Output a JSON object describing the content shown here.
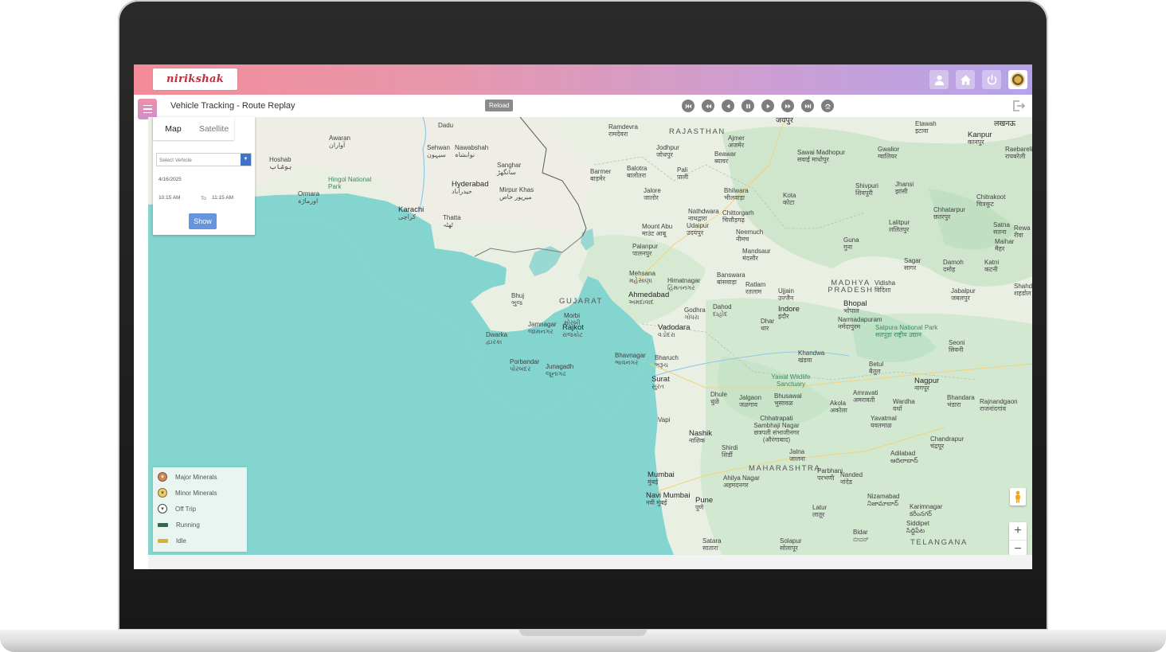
{
  "app": {
    "logo_text": "nirikshak",
    "page_title": "Vehicle Tracking - Route Replay",
    "reload_label": "Reload"
  },
  "header_icons": [
    "user-icon",
    "home-icon",
    "power-icon",
    "emblem-icon"
  ],
  "player_controls": [
    "skip-start-icon",
    "rewind-icon",
    "step-back-icon",
    "pause-icon",
    "play-icon",
    "fast-forward-icon",
    "skip-end-icon",
    "speed-icon"
  ],
  "map_type": {
    "tabs": [
      "Map",
      "Satellite"
    ],
    "active": "Map"
  },
  "filters": {
    "vehicle_placeholder": "Select Vehicle",
    "date": "4/16/2025",
    "time_from": "10:15 AM",
    "time_to_label": "To",
    "time_to": "11:15 AM",
    "show_label": "Show"
  },
  "legend": [
    {
      "label": "Major Minerals",
      "color": "#c98858"
    },
    {
      "label": "Minor Minerals",
      "color": "#e8cd7a"
    },
    {
      "label": "Off Trip",
      "color": "#ffffff"
    },
    {
      "label": "Running",
      "color": "#2f6b4a"
    },
    {
      "label": "Idle",
      "color": "#d6b13a"
    }
  ],
  "map": {
    "states": [
      "RAJASTHAN",
      "GUJARAT",
      "MADHYA PRADESH",
      "MAHARASHTRA",
      "TELANGANA"
    ],
    "cities": [
      {
        "name": "Dadu",
        "sub": ""
      },
      {
        "name": "Ramdevra",
        "sub": "रामदेवरा"
      },
      {
        "name": "जयपुर",
        "sub": ""
      },
      {
        "name": "Etawah",
        "sub": "इटावा"
      },
      {
        "name": "लखनऊ",
        "sub": ""
      },
      {
        "name": "Kanpur",
        "sub": "कानपुर"
      },
      {
        "name": "Awaran",
        "sub": "آواران"
      },
      {
        "name": "Sehwan",
        "sub": "سیہون"
      },
      {
        "name": "Nawabshah",
        "sub": "نوابشاہ"
      },
      {
        "name": "Jodhpur",
        "sub": "जोधपुर"
      },
      {
        "name": "Ajmer",
        "sub": "अजमेर"
      },
      {
        "name": "Gwalior",
        "sub": "ग्वालियर"
      },
      {
        "name": "Raebareli",
        "sub": "रायबरेली"
      },
      {
        "name": "Hoshab",
        "sub": "ہوشاب"
      },
      {
        "name": "Sanghar",
        "sub": "سانگھڑ"
      },
      {
        "name": "Beawar",
        "sub": "ब्यावर"
      },
      {
        "name": "Sawai Madhopur",
        "sub": "सवाई माधोपुर"
      },
      {
        "name": "Barmer",
        "sub": "बाड़मेर"
      },
      {
        "name": "Balotra",
        "sub": "बालोतरा"
      },
      {
        "name": "Pali",
        "sub": "पाली"
      },
      {
        "name": "Hingol National Park",
        "sub": ""
      },
      {
        "name": "Hyderabad",
        "sub": "حیدرآباد"
      },
      {
        "name": "Mirpur Khas",
        "sub": "میرپور خاص"
      },
      {
        "name": "Shivpuri",
        "sub": "शिवपुरी"
      },
      {
        "name": "Jhansi",
        "sub": "झांसी"
      },
      {
        "name": "Chitrakoot",
        "sub": "चित्रकूट"
      },
      {
        "name": "Jalore",
        "sub": "जालोर"
      },
      {
        "name": "Bhilwara",
        "sub": "भीलवाड़ा"
      },
      {
        "name": "Kota",
        "sub": "कोटा"
      },
      {
        "name": "Ormara",
        "sub": "اورماڑہ"
      },
      {
        "name": "Karachi",
        "sub": "کراچی"
      },
      {
        "name": "Thatta",
        "sub": "ٹھٹہ"
      },
      {
        "name": "Nathdwara",
        "sub": "नाथद्वारा"
      },
      {
        "name": "Chittorgarh",
        "sub": "चित्तौड़गढ़"
      },
      {
        "name": "Chhatarpur",
        "sub": "छतरपुर"
      },
      {
        "name": "Lalitpur",
        "sub": "ललितपुर"
      },
      {
        "name": "Mount Abu",
        "sub": "माउंट आबू"
      },
      {
        "name": "Udaipur",
        "sub": "उदयपुर"
      },
      {
        "name": "Neemuch",
        "sub": "नीमच"
      },
      {
        "name": "Satna",
        "sub": "सतना"
      },
      {
        "name": "Rewa",
        "sub": "रीवा"
      },
      {
        "name": "Guna",
        "sub": "गुना"
      },
      {
        "name": "Maihar",
        "sub": "मैहर"
      },
      {
        "name": "Palanpur",
        "sub": "पालनपुर"
      },
      {
        "name": "Mandsaur",
        "sub": "मंदसौर"
      },
      {
        "name": "Sagar",
        "sub": "सागर"
      },
      {
        "name": "Damoh",
        "sub": "दमोह"
      },
      {
        "name": "Katni",
        "sub": "कटनी"
      },
      {
        "name": "Mehsana",
        "sub": "મહેસાણા"
      },
      {
        "name": "Himatnagar",
        "sub": "હિંમતનગર"
      },
      {
        "name": "Banswara",
        "sub": "बांसवाड़ा"
      },
      {
        "name": "Vidisha",
        "sub": "विदिशा"
      },
      {
        "name": "Shahdol",
        "sub": "शहडोल"
      },
      {
        "name": "Ratlam",
        "sub": "रतलाम"
      },
      {
        "name": "Ujjain",
        "sub": "उज्जैन"
      },
      {
        "name": "Jabalpur",
        "sub": "जबलपुर"
      },
      {
        "name": "Bhuj",
        "sub": "ભુજ"
      },
      {
        "name": "Ahmedabad",
        "sub": "અમદાવાદ"
      },
      {
        "name": "Bhopal",
        "sub": "भोपाल"
      },
      {
        "name": "Morbi",
        "sub": "મોરબી"
      },
      {
        "name": "Godhra",
        "sub": "ગોધરા"
      },
      {
        "name": "Dahod",
        "sub": "દાહોદ"
      },
      {
        "name": "Indore",
        "sub": "इंदौर"
      },
      {
        "name": "Dhar",
        "sub": "धार"
      },
      {
        "name": "Narmadapuram",
        "sub": "नर्मदापुरम"
      },
      {
        "name": "Jamnagar",
        "sub": "જામનગર"
      },
      {
        "name": "Rajkot",
        "sub": "રાજકોટ"
      },
      {
        "name": "Vadodara",
        "sub": "વડોદરા"
      },
      {
        "name": "Satpura National Park",
        "sub": "सतपुड़ा राष्ट्रीय उद्यान"
      },
      {
        "name": "Dwarka",
        "sub": "દ્વારકા"
      },
      {
        "name": "Seoni",
        "sub": "सिवनी"
      },
      {
        "name": "Khandwa",
        "sub": "खंडवा"
      },
      {
        "name": "Bhavnagar",
        "sub": "ભાવનગર"
      },
      {
        "name": "Bharuch",
        "sub": "ભરૂચ"
      },
      {
        "name": "Porbandar",
        "sub": "પોરબંદર"
      },
      {
        "name": "Junagadh",
        "sub": "જૂનાગઢ"
      },
      {
        "name": "Betul",
        "sub": "बैतूल"
      },
      {
        "name": "Yawal Wildlife Sanctuary",
        "sub": ""
      },
      {
        "name": "Surat",
        "sub": "સુરત"
      },
      {
        "name": "Nagpur",
        "sub": "नागपूर"
      },
      {
        "name": "Amravati",
        "sub": "अमरावती"
      },
      {
        "name": "Bhandara",
        "sub": "भंडारा"
      },
      {
        "name": "Dhule",
        "sub": "धुळे"
      },
      {
        "name": "Jalgaon",
        "sub": "जळगाव"
      },
      {
        "name": "Bhusawal",
        "sub": "भुसावळ"
      },
      {
        "name": "Akola",
        "sub": "अकोला"
      },
      {
        "name": "Wardha",
        "sub": "वर्धा"
      },
      {
        "name": "Rajnandgaon",
        "sub": "राजनांदगांव"
      },
      {
        "name": "Vapi",
        "sub": ""
      },
      {
        "name": "Chhatrapati Sambhaji Nagar",
        "sub": "छत्रपती संभाजीनगर (औरंगाबाद)"
      },
      {
        "name": "Yavatmal",
        "sub": "यवतमाळ"
      },
      {
        "name": "Nashik",
        "sub": "नाशिक"
      },
      {
        "name": "Chandrapur",
        "sub": "चंद्रपूर"
      },
      {
        "name": "Shirdi",
        "sub": "शिर्डी"
      },
      {
        "name": "Jalna",
        "sub": "जालना"
      },
      {
        "name": "Adilabad",
        "sub": "ఆదిలాబాద్"
      },
      {
        "name": "Mumbai",
        "sub": "मुंबई"
      },
      {
        "name": "Ahilya Nagar",
        "sub": "अहमदनगर"
      },
      {
        "name": "Parbhani",
        "sub": "परभणी"
      },
      {
        "name": "Nanded",
        "sub": "नांदेड"
      },
      {
        "name": "Navi Mumbai",
        "sub": "नवी मुंबई"
      },
      {
        "name": "Pune",
        "sub": "पुणे"
      },
      {
        "name": "Nizamabad",
        "sub": "నిజామాబాద్"
      },
      {
        "name": "Karimnagar",
        "sub": "కరీంనగర్"
      },
      {
        "name": "Latur",
        "sub": "लातूर"
      },
      {
        "name": "Siddipet",
        "sub": "సిద్దిపేట"
      },
      {
        "name": "Bidar",
        "sub": "ಬೀದರ್"
      },
      {
        "name": "Satara",
        "sub": "सातारा"
      },
      {
        "name": "Solapur",
        "sub": "सोलापूर"
      }
    ]
  },
  "colors": {
    "header_gradient_start": "#f38c97",
    "header_gradient_end": "#b5a3ea",
    "sea": "#84d4cf",
    "land": "#e9efe3",
    "forest": "#bfe1c5",
    "show_button": "#6795dd"
  }
}
